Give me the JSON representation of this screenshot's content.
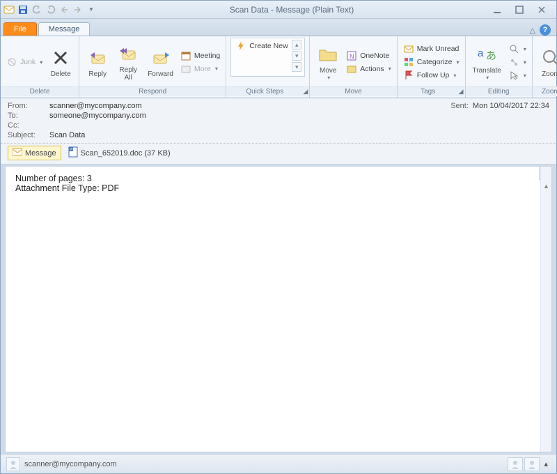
{
  "window": {
    "title": "Scan Data  -  Message (Plain Text)"
  },
  "tabs": {
    "file": "File",
    "message": "Message"
  },
  "ribbon": {
    "delete": {
      "junk": "Junk",
      "delete": "Delete",
      "group": "Delete"
    },
    "respond": {
      "reply": "Reply",
      "replyall": "Reply\nAll",
      "forward": "Forward",
      "meeting": "Meeting",
      "more": "More",
      "group": "Respond"
    },
    "quicksteps": {
      "create": "Create New",
      "group": "Quick Steps"
    },
    "move": {
      "move": "Move",
      "onenote": "OneNote",
      "actions": "Actions",
      "group": "Move"
    },
    "tags": {
      "unread": "Mark Unread",
      "categorize": "Categorize",
      "followup": "Follow Up",
      "group": "Tags"
    },
    "editing": {
      "translate": "Translate",
      "group": "Editing"
    },
    "zoom": {
      "zoom": "Zoom",
      "group": "Zoom"
    }
  },
  "headers": {
    "from_label": "From:",
    "from": "scanner@mycompany.com",
    "to_label": "To:",
    "to": "someone@mycompany.com",
    "cc_label": "Cc:",
    "cc": "",
    "subject_label": "Subject:",
    "subject": "Scan Data",
    "sent_label": "Sent:",
    "sent": "Mon 10/04/2017 22:34"
  },
  "attachments": {
    "message_tab": "Message",
    "file": "Scan_652019.doc (37 KB)"
  },
  "body": {
    "line1": "Number of pages: 3",
    "line2": "Attachment File Type: PDF"
  },
  "status": {
    "sender": "scanner@mycompany.com"
  }
}
